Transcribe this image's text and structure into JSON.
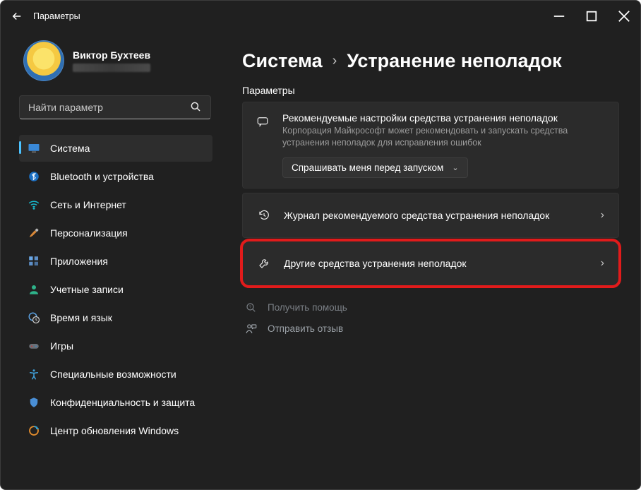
{
  "window": {
    "title": "Параметры"
  },
  "user": {
    "name": "Виктор Бухтеев"
  },
  "search": {
    "placeholder": "Найти параметр"
  },
  "sidebar": {
    "items": [
      {
        "label": "Система"
      },
      {
        "label": "Bluetooth и устройства"
      },
      {
        "label": "Сеть и Интернет"
      },
      {
        "label": "Персонализация"
      },
      {
        "label": "Приложения"
      },
      {
        "label": "Учетные записи"
      },
      {
        "label": "Время и язык"
      },
      {
        "label": "Игры"
      },
      {
        "label": "Специальные возможности"
      },
      {
        "label": "Конфиденциальность и защита"
      },
      {
        "label": "Центр обновления Windows"
      }
    ]
  },
  "breadcrumb": {
    "root": "Система",
    "current": "Устранение неполадок"
  },
  "section": {
    "label": "Параметры"
  },
  "recommended": {
    "title": "Рекомендуемые настройки средства устранения неполадок",
    "sub": "Корпорация Майкрософт может рекомендовать и запускать средства устранения неполадок для исправления ошибок",
    "dropdown": "Спрашивать меня перед запуском"
  },
  "rows": {
    "history": "Журнал рекомендуемого средства устранения неполадок",
    "other": "Другие средства устранения неполадок"
  },
  "help": {
    "get": "Получить помощь",
    "feedback": "Отправить отзыв"
  }
}
